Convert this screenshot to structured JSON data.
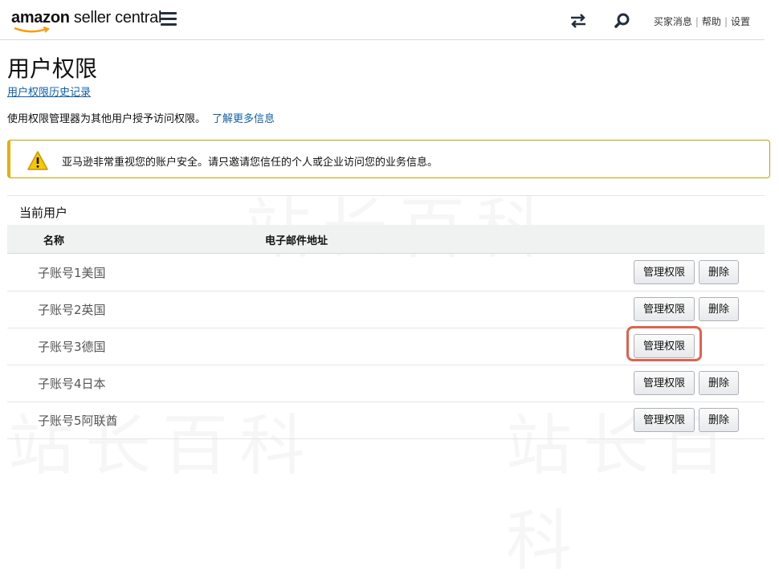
{
  "header": {
    "logo_amazon": "amazon",
    "logo_rest": " seller central",
    "links": [
      "买家消息",
      "帮助",
      "设置"
    ]
  },
  "page": {
    "title": "用户权限",
    "history_link": "用户权限历史记录",
    "description": "使用权限管理器为其他用户授予访问权限。",
    "learn_more": "了解更多信息"
  },
  "alert": {
    "text": "亚马逊非常重视您的账户安全。请只邀请您信任的个人或企业访问您的业务信息。"
  },
  "users": {
    "section_title": "当前用户",
    "columns": [
      "名称",
      "电子邮件地址"
    ],
    "rows": [
      {
        "name": "子账号1美国",
        "manage": "管理权限",
        "delete": "删除"
      },
      {
        "name": "子账号2英国",
        "manage": "管理权限",
        "delete": "删除"
      },
      {
        "name": "子账号3德国",
        "manage": "管理权限"
      },
      {
        "name": "子账号4日本",
        "manage": "管理权限",
        "delete": "删除"
      },
      {
        "name": "子账号5阿联酋",
        "manage": "管理权限",
        "delete": "删除"
      }
    ]
  },
  "colors": {
    "link": "#0f5ea8",
    "alert_border": "#e3b100",
    "highlight": "#e0624f"
  }
}
